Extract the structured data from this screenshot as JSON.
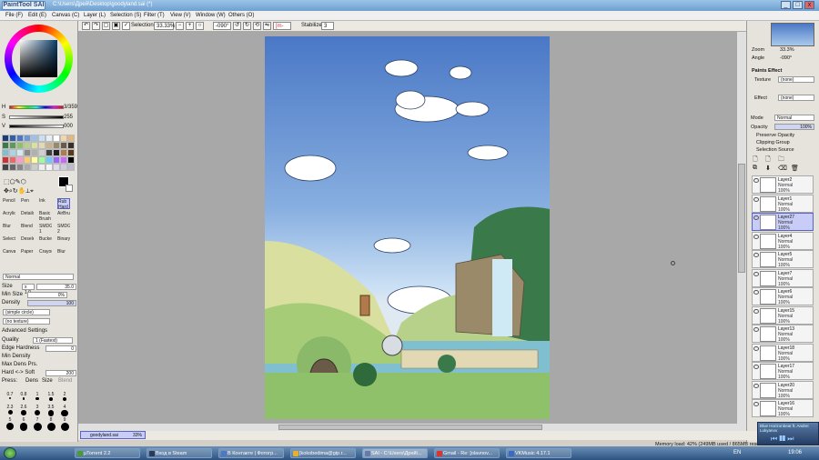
{
  "app": {
    "logo": "PaintTool SAI",
    "path": "C:\\Users\\Дрей\\Desktop\\goodyland.sai (*)",
    "btn_min": "_",
    "btn_max": "□",
    "btn_close": "x"
  },
  "menu": [
    "File (F)",
    "Edit (E)",
    "Canvas (C)",
    "Layer (L)",
    "Selection (S)",
    "Filter (T)",
    "View (V)",
    "Window (W)",
    "Others (O)"
  ],
  "toolbar": {
    "selection_label": "Selection",
    "zoom": "33.33%",
    "rotation": "-090°",
    "stabilizer_label": "Stabilizer",
    "stabilizer": "3",
    "minus_label": "[m-"
  },
  "color": {
    "h": "H",
    "h_val": "3/359",
    "s": "S",
    "s_val": "255",
    "v": "V",
    "v_val": "000"
  },
  "tools": [
    "Pencil",
    "Pen",
    "Ink",
    "Rub Hard",
    "Acrylic",
    "Details",
    "Basic Brush",
    "AirBrush",
    "Blur",
    "Blend",
    "SMDG 1",
    "SMDG 2",
    "Select",
    "Deselect",
    "Bucket",
    "Binary",
    "Canvas",
    "Paper",
    "Crayon",
    "Blur"
  ],
  "brush": {
    "mode": "Normal",
    "size_label": "Size",
    "size_mult": "x 1.0",
    "size": "35.0",
    "minsize_label": "Min Size",
    "minsize": "0%",
    "density_label": "Density",
    "density": "100",
    "shape": "(simple circle)",
    "texture": "(no texture)",
    "advanced": "Advanced Settings",
    "quality_label": "Quality",
    "quality": "1 (Fastest)",
    "edge_label": "Edge Hardness",
    "edge": "0",
    "mindens_label": "Min Density",
    "maxdens_label": "Max Dens Prs.",
    "hardsoft_label": "Hard <-> Soft",
    "hardsoft": "200",
    "press_label": "Press:",
    "dens_label": "Dens",
    "size_chk": "Size",
    "blend_label": "Blend"
  },
  "brush_sizes": [
    "0.7",
    "0.8",
    "1",
    "1.5",
    "2",
    "2.3",
    "2.6",
    "3",
    "3.5",
    "4",
    "5",
    "6",
    "7",
    "8",
    "9"
  ],
  "right": {
    "zoom_label": "Zoom",
    "zoom": "33.3%",
    "angle_label": "Angle",
    "angle": "-090°",
    "paints_effect": "Paints Effect",
    "texture_label": "Texture",
    "texture": "(none)",
    "effect_label": "Effect",
    "effect": "(none)",
    "mode_label": "Mode",
    "mode": "Normal",
    "opacity_label": "Opacity",
    "opacity": "100%",
    "preserve": "Preserve Opacity",
    "clipping": "Clipping Group",
    "selsrc": "Selection Source"
  },
  "layers": [
    {
      "name": "Layer2",
      "mode": "Normal",
      "op": "100%"
    },
    {
      "name": "Layer1",
      "mode": "Normal",
      "op": "100%"
    },
    {
      "name": "Layer27",
      "mode": "Normal",
      "op": "100%"
    },
    {
      "name": "Layer4",
      "mode": "Normal",
      "op": "100%"
    },
    {
      "name": "Layer5",
      "mode": "Normal",
      "op": "100%"
    },
    {
      "name": "Layer7",
      "mode": "Normal",
      "op": "100%"
    },
    {
      "name": "Layer6",
      "mode": "Normal",
      "op": "100%"
    },
    {
      "name": "Layer15",
      "mode": "Normal",
      "op": "100%"
    },
    {
      "name": "Layer13",
      "mode": "Normal",
      "op": "100%"
    },
    {
      "name": "Layer18",
      "mode": "Normal",
      "op": "100%"
    },
    {
      "name": "Layer17",
      "mode": "Normal",
      "op": "100%"
    },
    {
      "name": "Layer20",
      "mode": "Normal",
      "op": "100%"
    },
    {
      "name": "Layer16",
      "mode": "Normal",
      "op": "100%"
    }
  ],
  "status": {
    "doc": "goodyland.sai",
    "doc_zoom": "33%",
    "memory": "Memory load: 42% (249MB used / 865MB reser"
  },
  "taskbar": {
    "items": [
      "µTorrent 2.2",
      "Вход в Steam",
      "В Контакте | Фотогр...",
      "[kokobedima@gip.r...",
      "SAI - C:\\Users\\Дрей\\...",
      "Gmail - Re: [olavnov...",
      "VKMusic 4.17.1"
    ],
    "lang": "EN",
    "clock": "19:06",
    "popup": "Blue Horizonbeat ft. Andrei Lukyanov"
  },
  "colors": {
    "accent": "#5a62c2",
    "sky_top": "#4a78c6",
    "grass": "#8fc06a"
  }
}
